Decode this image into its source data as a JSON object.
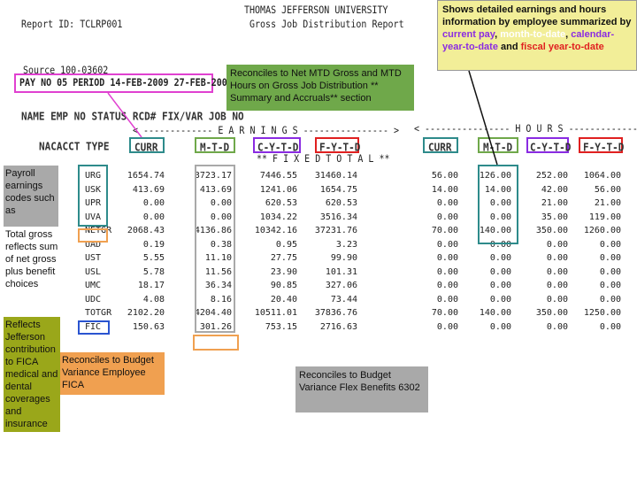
{
  "report": {
    "id_line": "Report ID:  TCLRP001",
    "university": "THOMAS JEFFERSON UNIVERSITY",
    "title": "Gross Job  Distribution Report",
    "source": "Source    100-03602",
    "pay_period": "PAY NO 05 PERIOD 14-FEB-2009  27-FEB-2009",
    "col_row1": "NAME               EMP NO   STATUS   RCD#  FIX/VAR  JOB NO",
    "col_row2_a": "NACACCT   TYPE",
    "earnings_banner": "< ------------- E A R N I N G S ---------------- >",
    "fixed_total": "** F I X E D   T O T A L **",
    "hours_banner": "<  ---------------- H O U R S  ---------------->",
    "earn_cols": [
      "CURR",
      "M-T-D",
      "C-Y-T-D",
      "F-Y-T-D"
    ],
    "hour_cols": [
      "CURR",
      "M-T-D",
      "C-Y-T-D",
      "F-Y-T-D"
    ]
  },
  "rows": [
    {
      "type": "URG",
      "e": [
        "1654.74",
        "3723.17",
        "7446.55",
        "31460.14"
      ],
      "h": [
        "56.00",
        "126.00",
        "252.00",
        "1064.00"
      ]
    },
    {
      "type": "USK",
      "e": [
        "413.69",
        "413.69",
        "1241.06",
        "1654.75"
      ],
      "h": [
        "14.00",
        "14.00",
        "42.00",
        "56.00"
      ]
    },
    {
      "type": "UPR",
      "e": [
        "0.00",
        "0.00",
        "620.53",
        "620.53"
      ],
      "h": [
        "0.00",
        "0.00",
        "21.00",
        "21.00"
      ]
    },
    {
      "type": "UVA",
      "e": [
        "0.00",
        "0.00",
        "1034.22",
        "3516.34"
      ],
      "h": [
        "0.00",
        "0.00",
        "35.00",
        "119.00"
      ]
    },
    {
      "type": "NETGR",
      "e": [
        "2068.43",
        "4136.86",
        "10342.16",
        "37231.76"
      ],
      "h": [
        "70.00",
        "140.00",
        "350.00",
        "1260.00"
      ]
    },
    {
      "type": "UAD",
      "e": [
        "0.19",
        "0.38",
        "0.95",
        "3.23"
      ],
      "h": [
        "0.00",
        "0.00",
        "0.00",
        "0.00"
      ]
    },
    {
      "type": "UST",
      "e": [
        "5.55",
        "11.10",
        "27.75",
        "99.90"
      ],
      "h": [
        "0.00",
        "0.00",
        "0.00",
        "0.00"
      ]
    },
    {
      "type": "USL",
      "e": [
        "5.78",
        "11.56",
        "23.90",
        "101.31"
      ],
      "h": [
        "0.00",
        "0.00",
        "0.00",
        "0.00"
      ]
    },
    {
      "type": "UMC",
      "e": [
        "18.17",
        "36.34",
        "90.85",
        "327.06"
      ],
      "h": [
        "0.00",
        "0.00",
        "0.00",
        "0.00"
      ]
    },
    {
      "type": "UDC",
      "e": [
        "4.08",
        "8.16",
        "20.40",
        "73.44"
      ],
      "h": [
        "0.00",
        "0.00",
        "0.00",
        "0.00"
      ]
    },
    {
      "type": "TOTGR",
      "e": [
        "2102.20",
        "4204.40",
        "10511.01",
        "37836.76"
      ],
      "h": [
        "70.00",
        "140.00",
        "350.00",
        "1250.00"
      ]
    },
    {
      "type": "FIC",
      "e": [
        "150.63",
        "301.26",
        "753.15",
        "2716.63"
      ],
      "h": [
        "0.00",
        "0.00",
        "0.00",
        "0.00"
      ]
    }
  ],
  "callouts": {
    "top_right": {
      "pre": "Shows detailed earnings and hours information by employee summarized by ",
      "curr": "current pay",
      "sep1": ", ",
      "mtd": "month-to-date",
      "sep2": ", ",
      "cytd": "calendar-year-to-date",
      "sep3": " and ",
      "fytd": "fiscal year-to-date"
    },
    "reconcile_mtd": "Reconciles to Net MTD Gross and MTD Hours on Gross Job Distribution ** Summary and Accruals** section",
    "payroll_codes": "Payroll earnings codes such as",
    "total_gross": "Total gross reflects sum of net gross plus benefit choices",
    "jefferson": "Reflects Jefferson contribution to FICA medical and dental coverages and insurance",
    "fica": "Reconciles to Budget Variance Employee FICA",
    "flex": "Reconciles to Budget Variance Flex Benefits 6302"
  },
  "colors": {
    "teal": "#2e8b8b",
    "pink": "#e040d0",
    "purple": "#8a2be2",
    "red": "#e02020",
    "orange": "#f0a050",
    "green_box": "#6fa84a",
    "note_bg": "#a7c97a",
    "gray_bg": "#a9a9a9",
    "yellow": "#f2ee98",
    "olive_bg": "#9aa71a",
    "blue": "#2a54d0"
  }
}
